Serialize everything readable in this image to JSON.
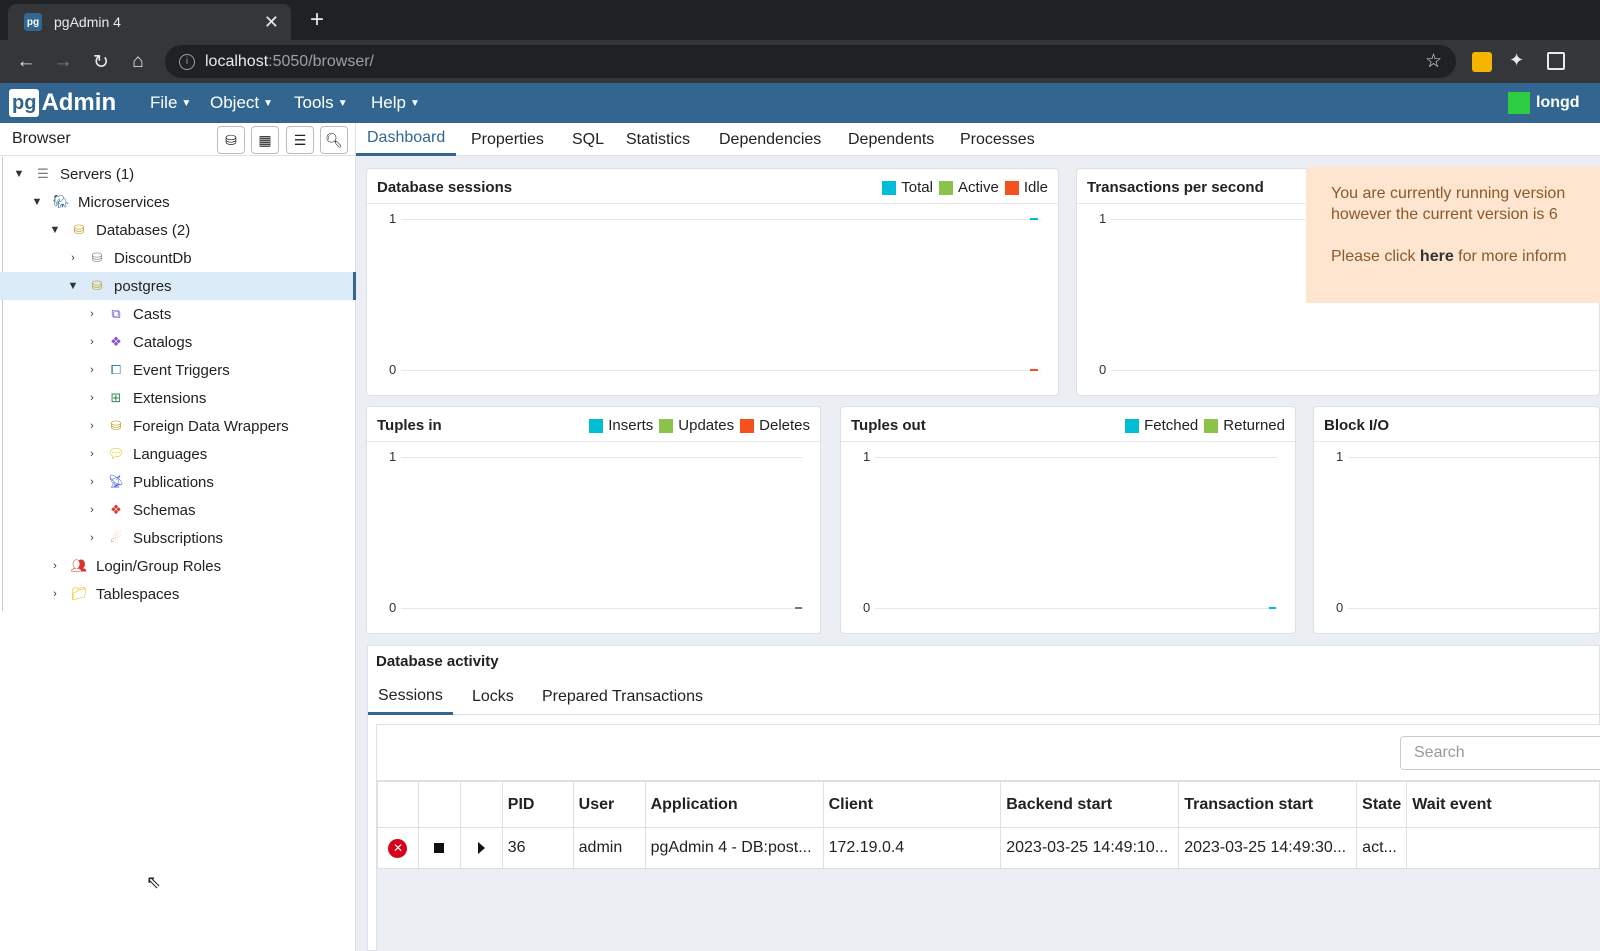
{
  "browser": {
    "tab_title": "pgAdmin 4",
    "favicon_text": "pg",
    "url_host": "localhost",
    "url_path": ":5050/browser/"
  },
  "header": {
    "logo_pg": "pg",
    "logo_admin": "Admin",
    "menus": [
      "File",
      "Object",
      "Tools",
      "Help"
    ],
    "user": "longd"
  },
  "browser_panel": {
    "title": "Browser",
    "tree": [
      {
        "label": "Servers (1)",
        "icon": "servers-icon",
        "expanded": true
      },
      {
        "label": "Microservices",
        "icon": "postgres-server-icon",
        "expanded": true
      },
      {
        "label": "Databases (2)",
        "icon": "databases-icon",
        "expanded": true
      },
      {
        "label": "DiscountDb",
        "icon": "database-disconnected-icon",
        "expanded": false
      },
      {
        "label": "postgres",
        "icon": "database-icon",
        "expanded": true,
        "selected": true
      },
      {
        "label": "Casts",
        "icon": "casts-icon",
        "expanded": false
      },
      {
        "label": "Catalogs",
        "icon": "catalogs-icon",
        "expanded": false
      },
      {
        "label": "Event Triggers",
        "icon": "event-triggers-icon",
        "expanded": false
      },
      {
        "label": "Extensions",
        "icon": "extensions-icon",
        "expanded": false
      },
      {
        "label": "Foreign Data Wrappers",
        "icon": "fdw-icon",
        "expanded": false
      },
      {
        "label": "Languages",
        "icon": "languages-icon",
        "expanded": false
      },
      {
        "label": "Publications",
        "icon": "publications-icon",
        "expanded": false
      },
      {
        "label": "Schemas",
        "icon": "schemas-icon",
        "expanded": false
      },
      {
        "label": "Subscriptions",
        "icon": "subscriptions-icon",
        "expanded": false
      },
      {
        "label": "Login/Group Roles",
        "icon": "roles-icon",
        "expanded": false
      },
      {
        "label": "Tablespaces",
        "icon": "tablespaces-icon",
        "expanded": false
      }
    ]
  },
  "main_tabs": [
    "Dashboard",
    "Properties",
    "SQL",
    "Statistics",
    "Dependencies",
    "Dependents",
    "Processes"
  ],
  "charts": {
    "sessions": {
      "title": "Database sessions",
      "legend": [
        "Total",
        "Active",
        "Idle"
      ],
      "y_top": "1",
      "y_bottom": "0"
    },
    "tps": {
      "title": "Transactions per second",
      "y_top": "1",
      "y_bottom": "0"
    },
    "tuples_in": {
      "title": "Tuples in",
      "legend": [
        "Inserts",
        "Updates",
        "Deletes"
      ],
      "y_top": "1",
      "y_bottom": "0"
    },
    "tuples_out": {
      "title": "Tuples out",
      "legend": [
        "Fetched",
        "Returned"
      ],
      "y_top": "1",
      "y_bottom": "0"
    },
    "block_io": {
      "title": "Block I/O",
      "y_top": "1",
      "y_bottom": "0"
    }
  },
  "colors": {
    "teal": "#00bcd4",
    "green": "#8bc34a",
    "orange": "#f4511e",
    "brand": "#326690"
  },
  "notice": {
    "line1": "You are currently running version",
    "line2": "however the current version is 6",
    "line3_pre": "Please click ",
    "line3_link": "here",
    "line3_post": " for more inform"
  },
  "activity": {
    "title": "Database activity",
    "tabs": [
      "Sessions",
      "Locks",
      "Prepared Transactions"
    ],
    "search_placeholder": "Search",
    "columns": [
      "PID",
      "User",
      "Application",
      "Client",
      "Backend start",
      "Transaction start",
      "State",
      "Wait event"
    ],
    "rows": [
      {
        "pid": "36",
        "user": "admin",
        "application": "pgAdmin 4 - DB:post...",
        "client": "172.19.0.4",
        "backend_start": "2023-03-25 14:49:10...",
        "transaction_start": "2023-03-25 14:49:30...",
        "state": "act...",
        "wait_event": ""
      }
    ]
  }
}
